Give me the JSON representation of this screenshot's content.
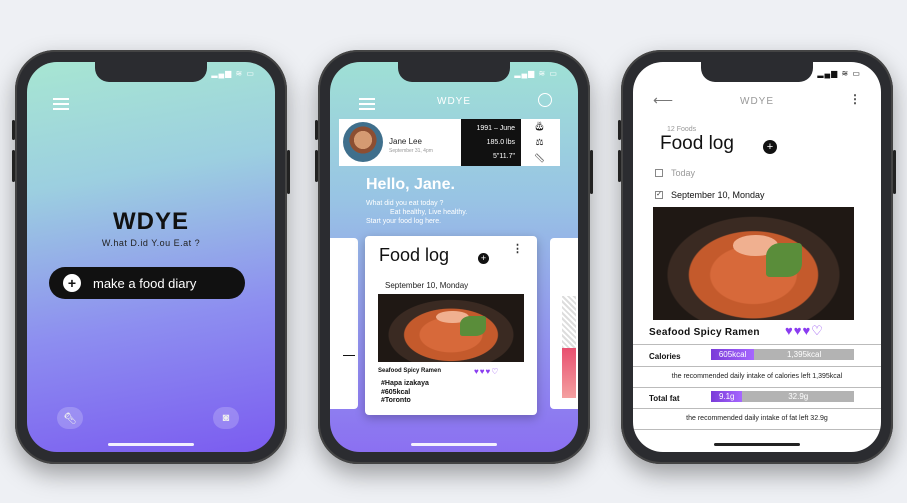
{
  "phone1": {
    "title": "WDYE",
    "subtitle": "W.hat D.id Y.ou E.at ?",
    "cta_label": "make a food diary"
  },
  "phone2": {
    "app_title": "WDYE",
    "profile": {
      "name": "Jane Lee",
      "date": "September 31, 4pm",
      "birth": "1991 – June",
      "weight": "185.0 lbs",
      "height": "5\"11.7\""
    },
    "greeting": "Hello, Jane.",
    "lines": [
      "What did you eat today ?",
      "Eat healthy, Live healthy.",
      "Start your food log here."
    ],
    "card": {
      "title": "Food log",
      "date": "September 10, Monday",
      "food_name": "Seafood Spicy Ramen",
      "hearts": "♥♥♥♡",
      "tags": [
        "#Hapa izakaya",
        "#605kcal",
        "#Toronto"
      ]
    }
  },
  "phone3": {
    "app_title": "WDYE",
    "count": "12 Foods",
    "title": "Food log",
    "today_label": "Today",
    "date_label": "September 10, Monday",
    "food_name": "Seafood Spicy Ramen",
    "hearts": "♥♥♥♡",
    "calories": {
      "label": "Calories",
      "eaten": "605kcal",
      "left": "1,395kcal",
      "fraction": 0.3025
    },
    "calories_note": "the recommended daily intake of calories left 1,395kcal",
    "fat": {
      "label": "Total fat",
      "eaten": "9.1g",
      "left": "32.9g",
      "fraction": 0.22
    },
    "fat_note": "the recommended daily intake of fat left 32.9g"
  }
}
